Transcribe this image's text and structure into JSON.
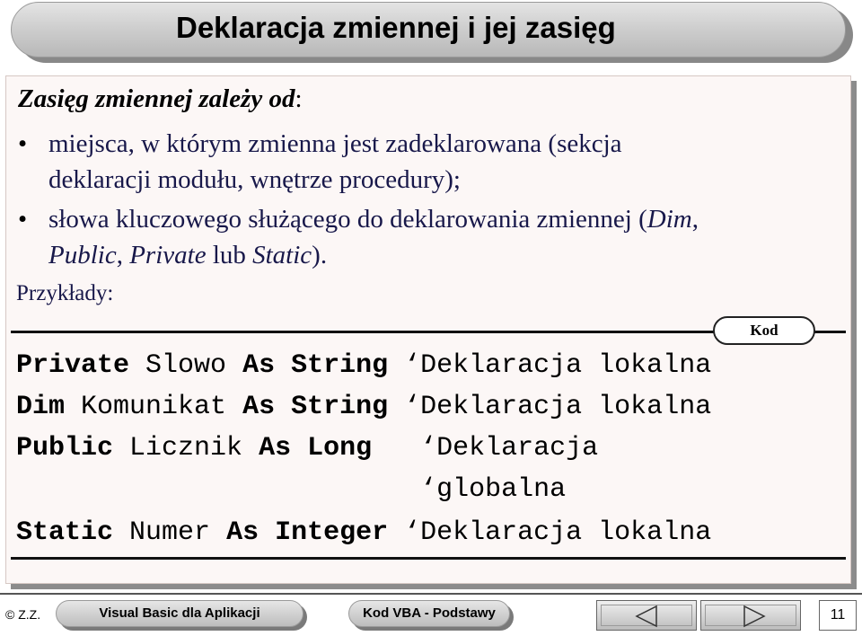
{
  "title": "Deklaracja zmiennej i jej zasięg",
  "heading": {
    "main": "Zasięg zmiennej zależy od",
    "colon": ":"
  },
  "bullets": [
    {
      "line1": "miejsca, w którym zmienna jest zadeklarowana (sekcja",
      "line2": "deklaracji modułu, wnętrze procedury);"
    },
    {
      "line1_a": "słowa kluczowego służącego do deklarowania zmiennej (",
      "line1_b": "Dim",
      "line1_c": ",",
      "line2_a": "Public",
      "line2_b": ", ",
      "line2_c": "Private",
      "line2_d": " lub ",
      "line2_e": "Static",
      "line2_f": ")."
    }
  ],
  "bullet_symbol": "•",
  "examples_label": "Przykłady:",
  "code_tag": "Kod",
  "code_lines": [
    {
      "kw1": "Private",
      "name": " Slowo ",
      "kw2": "As",
      "sp": " ",
      "type": "String",
      "pad": " ",
      "comment": "‘Deklaracja lokalna"
    },
    {
      "kw1": "Dim",
      "name": " Komunikat ",
      "kw2": "As",
      "sp": " ",
      "type": "String",
      "pad": " ",
      "comment": "‘Deklaracja lokalna"
    },
    {
      "kw1": "Public",
      "name": " Licznik ",
      "kw2": "As",
      "sp": " ",
      "type": "Long",
      "pad": "   ",
      "comment": "‘Deklaracja"
    },
    {
      "pad": "                         ",
      "comment": "‘globalna"
    },
    {
      "kw1": "Static",
      "name": " Numer ",
      "kw2": "As",
      "sp": " ",
      "type": "Integer",
      "pad": " ",
      "comment": "‘Deklaracja lokalna"
    }
  ],
  "footer": {
    "copyright": "© Z.Z.",
    "course": "Visual Basic dla Aplikacji",
    "topic": "Kod VBA - Podstawy",
    "page_number": "11"
  },
  "nav_icons": [
    "first-page-icon",
    "prev-page-icon",
    "next-page-icon"
  ]
}
